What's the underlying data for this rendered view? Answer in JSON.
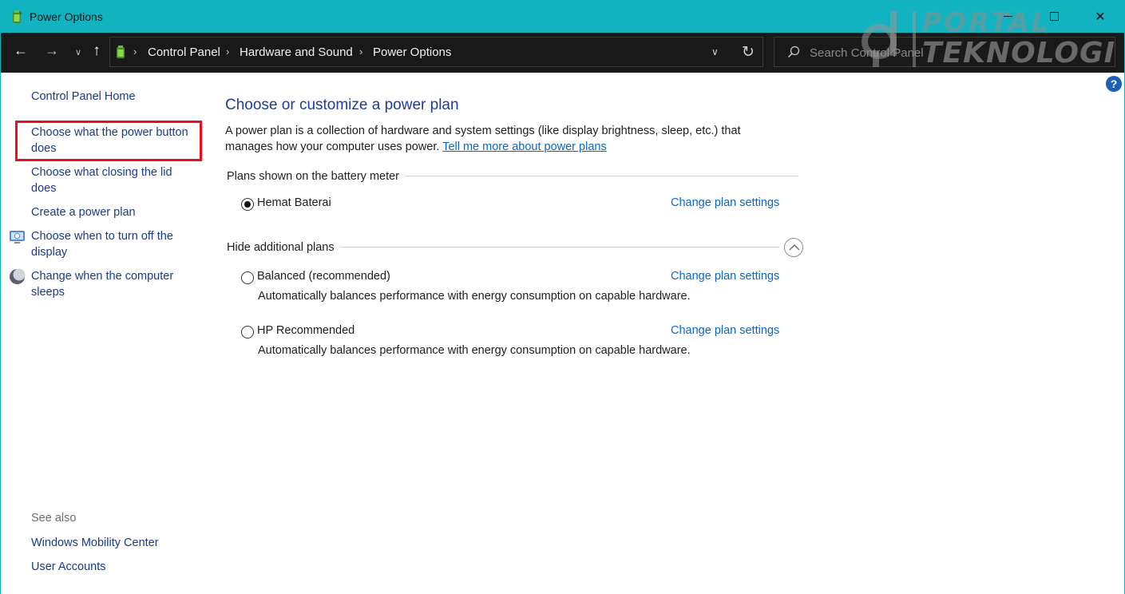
{
  "window": {
    "title": "Power Options",
    "icon": "power-options-icon"
  },
  "watermark": {
    "line1": "PORTAL",
    "line2": "TEKNOLOGI"
  },
  "navigation": {
    "back_icon": "arrow-left-icon",
    "forward_icon": "arrow-right-icon",
    "recent_icon": "chevron-down-icon",
    "up_icon": "arrow-up-icon",
    "breadcrumb": [
      "Control Panel",
      "Hardware and Sound",
      "Power Options"
    ],
    "search_placeholder": "Search Control Panel"
  },
  "sidebar": {
    "home": "Control Panel Home",
    "tasks": [
      "Choose what the power button does",
      "Choose what closing the lid does",
      "Create a power plan",
      "Choose when to turn off the display",
      "Change when the computer sleeps"
    ],
    "see_also_label": "See also",
    "see_also": [
      "Windows Mobility Center",
      "User Accounts"
    ]
  },
  "main": {
    "title": "Choose or customize a power plan",
    "description": "A power plan is a collection of hardware and system settings (like display brightness, sleep, etc.) that manages how your computer uses power.",
    "learn_more": "Tell me more about power plans",
    "battery_section": "Plans shown on the battery meter",
    "additional_section": "Hide additional plans",
    "change_label": "Change plan settings",
    "plans": [
      {
        "name": "Hemat Baterai",
        "selected": true,
        "description": ""
      },
      {
        "name": "Balanced (recommended)",
        "selected": false,
        "description": "Automatically balances performance with energy consumption on capable hardware."
      },
      {
        "name": "HP Recommended",
        "selected": false,
        "description": "Automatically balances performance with energy consumption on capable hardware."
      }
    ]
  },
  "colors": {
    "titlebar": "#12b3c0",
    "addressbar": "#191919",
    "link": "#0a66c8",
    "heading": "#1d3c96",
    "highlight": "#e8101e"
  }
}
